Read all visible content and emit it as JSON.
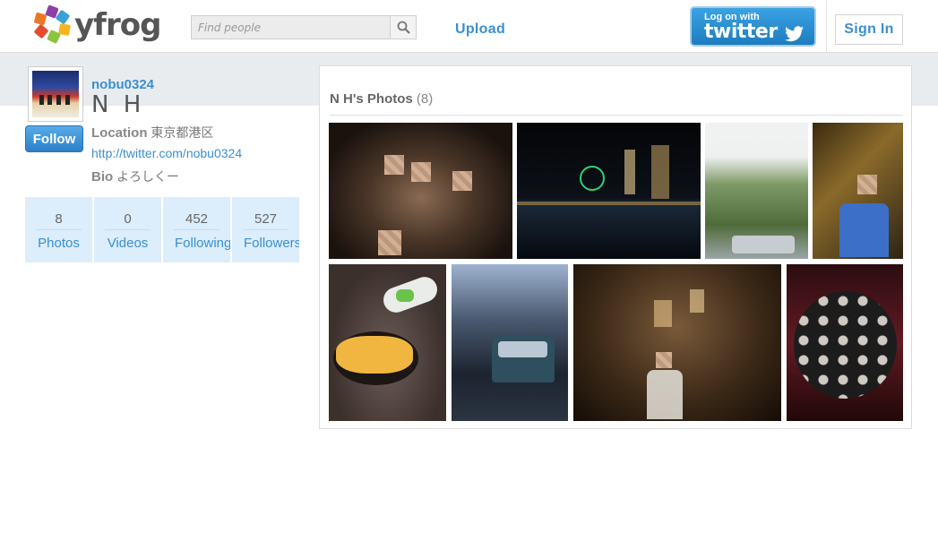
{
  "header": {
    "logo_text": "yfrog",
    "search_placeholder": "Find people",
    "upload_label": "Upload",
    "twitter_small": "Log on with",
    "twitter_big": "twitter",
    "signin_label": "Sign In"
  },
  "profile": {
    "username": "nobu0324",
    "display_name": "N H",
    "follow_label": "Follow",
    "location_label": "Location",
    "location_value": "東京都港区",
    "twitter_url": "http://twitter.com/nobu0324",
    "bio_label": "Bio",
    "bio_value": "よろしくー"
  },
  "stats": [
    {
      "count": "8",
      "label": "Photos"
    },
    {
      "count": "0",
      "label": "Videos"
    },
    {
      "count": "452",
      "label": "Following"
    },
    {
      "count": "527",
      "label": "Followers"
    }
  ],
  "photos_panel": {
    "title": "N H's Photos",
    "count": "(8)"
  },
  "colors": {
    "accent_blue": "#3a8fd0",
    "band_grey": "#e8ecef",
    "stat_bg": "#dcedfb"
  },
  "icons": [
    "search-icon",
    "twitter-bird-icon",
    "yfrog-logo-icon"
  ]
}
